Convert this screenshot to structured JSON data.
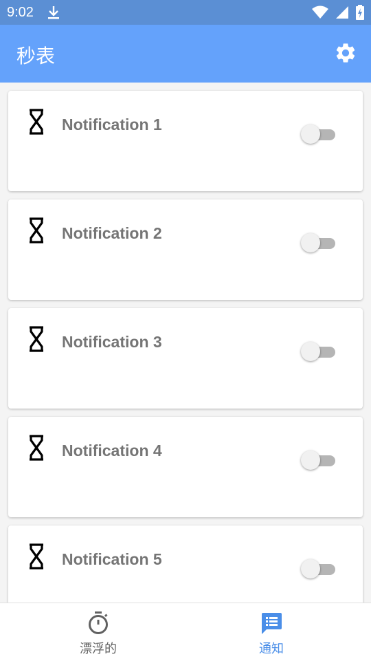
{
  "status_bar": {
    "time": "9:02",
    "icons": [
      "download-icon",
      "wifi-icon",
      "signal-icon",
      "battery-charging-icon"
    ]
  },
  "app_bar": {
    "title": "秒表",
    "settings_icon": "gear-icon"
  },
  "notifications": [
    {
      "label": "Notification 1",
      "icon": "hourglass-icon",
      "enabled": false
    },
    {
      "label": "Notification 2",
      "icon": "hourglass-icon",
      "enabled": false
    },
    {
      "label": "Notification 3",
      "icon": "hourglass-icon",
      "enabled": false
    },
    {
      "label": "Notification 4",
      "icon": "hourglass-icon",
      "enabled": false
    },
    {
      "label": "Notification 5",
      "icon": "hourglass-icon",
      "enabled": false
    }
  ],
  "bottom_nav": {
    "items": [
      {
        "label": "漂浮的",
        "icon": "stopwatch-icon",
        "active": false
      },
      {
        "label": "通知",
        "icon": "notification-list-icon",
        "active": true
      }
    ]
  },
  "colors": {
    "status_bar": "#5b8fd4",
    "app_bar": "#64a2fb",
    "accent": "#4a8ee8",
    "inactive_nav": "#616161"
  }
}
